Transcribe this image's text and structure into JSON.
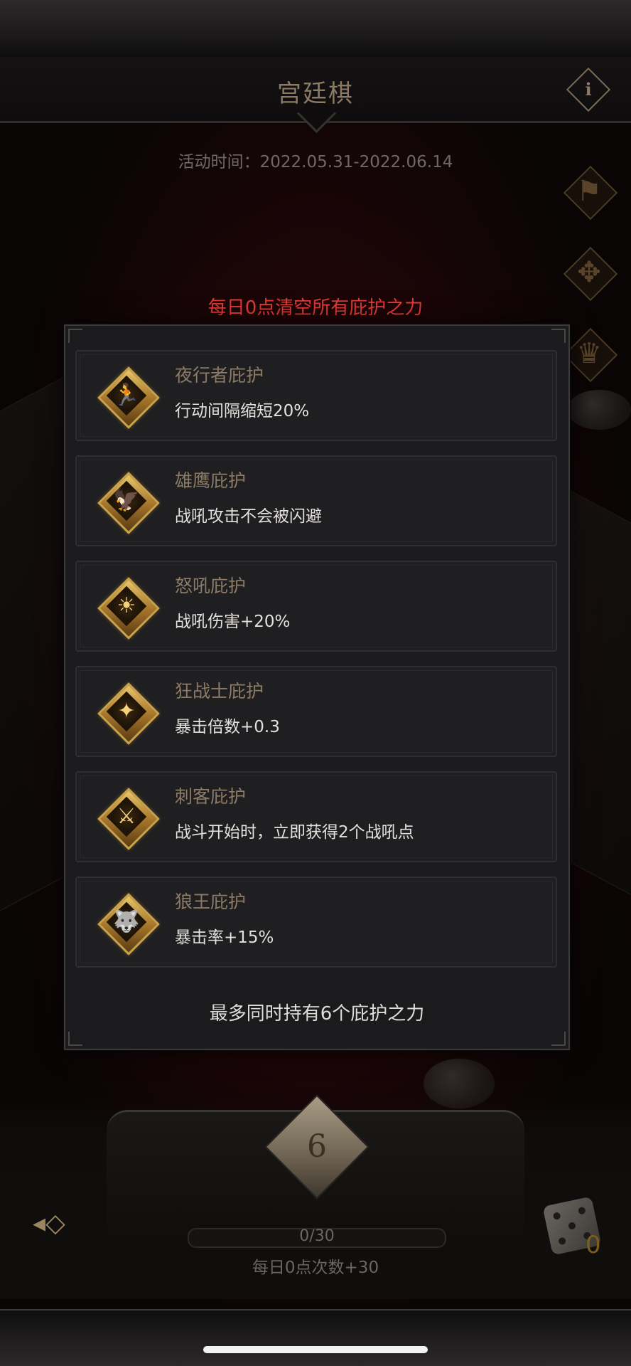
{
  "header": {
    "title": "宫廷棋",
    "info_glyph": "i",
    "activity_time": "活动时间：2022.05.31-2022.06.14"
  },
  "side_icons": [
    {
      "name": "banner-icon",
      "glyph": "⚑"
    },
    {
      "name": "compass-icon",
      "glyph": "✥"
    },
    {
      "name": "trophy-icon",
      "glyph": "♛"
    }
  ],
  "notice": "每日0点清空所有庇护之力",
  "blessings": [
    {
      "name": "夜行者庇护",
      "desc": "行动间隔缩短20%",
      "icon": "running-figure-icon",
      "glyph": "🏃"
    },
    {
      "name": "雄鹰庇护",
      "desc": "战吼攻击不会被闪避",
      "icon": "eagle-claw-icon",
      "glyph": "🦅"
    },
    {
      "name": "怒吼庇护",
      "desc": "战吼伤害+20%",
      "icon": "roaring-figure-icon",
      "glyph": "☀"
    },
    {
      "name": "狂战士庇护",
      "desc": "暴击倍数+0.3",
      "icon": "berserker-icon",
      "glyph": "✦"
    },
    {
      "name": "刺客庇护",
      "desc": "战斗开始时，立即获得2个战吼点",
      "icon": "assassin-blade-icon",
      "glyph": "⚔"
    },
    {
      "name": "狼王庇护",
      "desc": "暴击率+15%",
      "icon": "wolf-head-icon",
      "glyph": "🐺"
    }
  ],
  "max_note": "最多同时持有6个庇护之力",
  "dice": {
    "die_glyph": "6",
    "progress_text": "0/30",
    "progress_fraction": 0,
    "daily_text": "每日0点次数+30",
    "dice_count": "0",
    "back_glyph": "◂◇"
  },
  "colors": {
    "notice_red": "#e03a36",
    "gold": "#c9a24a",
    "title_brown": "#8a7a66"
  }
}
